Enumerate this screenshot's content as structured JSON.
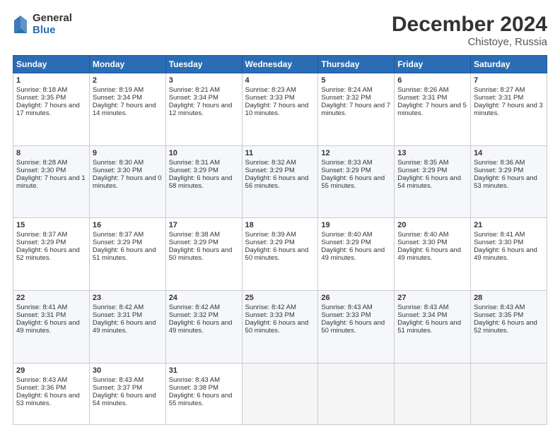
{
  "logo": {
    "general": "General",
    "blue": "Blue"
  },
  "title": "December 2024",
  "subtitle": "Chistoye, Russia",
  "weekdays": [
    "Sunday",
    "Monday",
    "Tuesday",
    "Wednesday",
    "Thursday",
    "Friday",
    "Saturday"
  ],
  "weeks": [
    [
      {
        "day": "1",
        "sunrise": "8:18 AM",
        "sunset": "3:35 PM",
        "daylight": "7 hours and 17 minutes."
      },
      {
        "day": "2",
        "sunrise": "8:19 AM",
        "sunset": "3:34 PM",
        "daylight": "7 hours and 14 minutes."
      },
      {
        "day": "3",
        "sunrise": "8:21 AM",
        "sunset": "3:34 PM",
        "daylight": "7 hours and 12 minutes."
      },
      {
        "day": "4",
        "sunrise": "8:23 AM",
        "sunset": "3:33 PM",
        "daylight": "7 hours and 10 minutes."
      },
      {
        "day": "5",
        "sunrise": "8:24 AM",
        "sunset": "3:32 PM",
        "daylight": "7 hours and 7 minutes."
      },
      {
        "day": "6",
        "sunrise": "8:26 AM",
        "sunset": "3:31 PM",
        "daylight": "7 hours and 5 minutes."
      },
      {
        "day": "7",
        "sunrise": "8:27 AM",
        "sunset": "3:31 PM",
        "daylight": "7 hours and 3 minutes."
      }
    ],
    [
      {
        "day": "8",
        "sunrise": "8:28 AM",
        "sunset": "3:30 PM",
        "daylight": "7 hours and 1 minute."
      },
      {
        "day": "9",
        "sunrise": "8:30 AM",
        "sunset": "3:30 PM",
        "daylight": "7 hours and 0 minutes."
      },
      {
        "day": "10",
        "sunrise": "8:31 AM",
        "sunset": "3:29 PM",
        "daylight": "6 hours and 58 minutes."
      },
      {
        "day": "11",
        "sunrise": "8:32 AM",
        "sunset": "3:29 PM",
        "daylight": "6 hours and 56 minutes."
      },
      {
        "day": "12",
        "sunrise": "8:33 AM",
        "sunset": "3:29 PM",
        "daylight": "6 hours and 55 minutes."
      },
      {
        "day": "13",
        "sunrise": "8:35 AM",
        "sunset": "3:29 PM",
        "daylight": "6 hours and 54 minutes."
      },
      {
        "day": "14",
        "sunrise": "8:36 AM",
        "sunset": "3:29 PM",
        "daylight": "6 hours and 53 minutes."
      }
    ],
    [
      {
        "day": "15",
        "sunrise": "8:37 AM",
        "sunset": "3:29 PM",
        "daylight": "6 hours and 52 minutes."
      },
      {
        "day": "16",
        "sunrise": "8:37 AM",
        "sunset": "3:29 PM",
        "daylight": "6 hours and 51 minutes."
      },
      {
        "day": "17",
        "sunrise": "8:38 AM",
        "sunset": "3:29 PM",
        "daylight": "6 hours and 50 minutes."
      },
      {
        "day": "18",
        "sunrise": "8:39 AM",
        "sunset": "3:29 PM",
        "daylight": "6 hours and 50 minutes."
      },
      {
        "day": "19",
        "sunrise": "8:40 AM",
        "sunset": "3:29 PM",
        "daylight": "6 hours and 49 minutes."
      },
      {
        "day": "20",
        "sunrise": "8:40 AM",
        "sunset": "3:30 PM",
        "daylight": "6 hours and 49 minutes."
      },
      {
        "day": "21",
        "sunrise": "8:41 AM",
        "sunset": "3:30 PM",
        "daylight": "6 hours and 49 minutes."
      }
    ],
    [
      {
        "day": "22",
        "sunrise": "8:41 AM",
        "sunset": "3:31 PM",
        "daylight": "6 hours and 49 minutes."
      },
      {
        "day": "23",
        "sunrise": "8:42 AM",
        "sunset": "3:31 PM",
        "daylight": "6 hours and 49 minutes."
      },
      {
        "day": "24",
        "sunrise": "8:42 AM",
        "sunset": "3:32 PM",
        "daylight": "6 hours and 49 minutes."
      },
      {
        "day": "25",
        "sunrise": "8:42 AM",
        "sunset": "3:33 PM",
        "daylight": "6 hours and 50 minutes."
      },
      {
        "day": "26",
        "sunrise": "8:43 AM",
        "sunset": "3:33 PM",
        "daylight": "6 hours and 50 minutes."
      },
      {
        "day": "27",
        "sunrise": "8:43 AM",
        "sunset": "3:34 PM",
        "daylight": "6 hours and 51 minutes."
      },
      {
        "day": "28",
        "sunrise": "8:43 AM",
        "sunset": "3:35 PM",
        "daylight": "6 hours and 52 minutes."
      }
    ],
    [
      {
        "day": "29",
        "sunrise": "8:43 AM",
        "sunset": "3:36 PM",
        "daylight": "6 hours and 53 minutes."
      },
      {
        "day": "30",
        "sunrise": "8:43 AM",
        "sunset": "3:37 PM",
        "daylight": "6 hours and 54 minutes."
      },
      {
        "day": "31",
        "sunrise": "8:43 AM",
        "sunset": "3:38 PM",
        "daylight": "6 hours and 55 minutes."
      },
      null,
      null,
      null,
      null
    ]
  ]
}
